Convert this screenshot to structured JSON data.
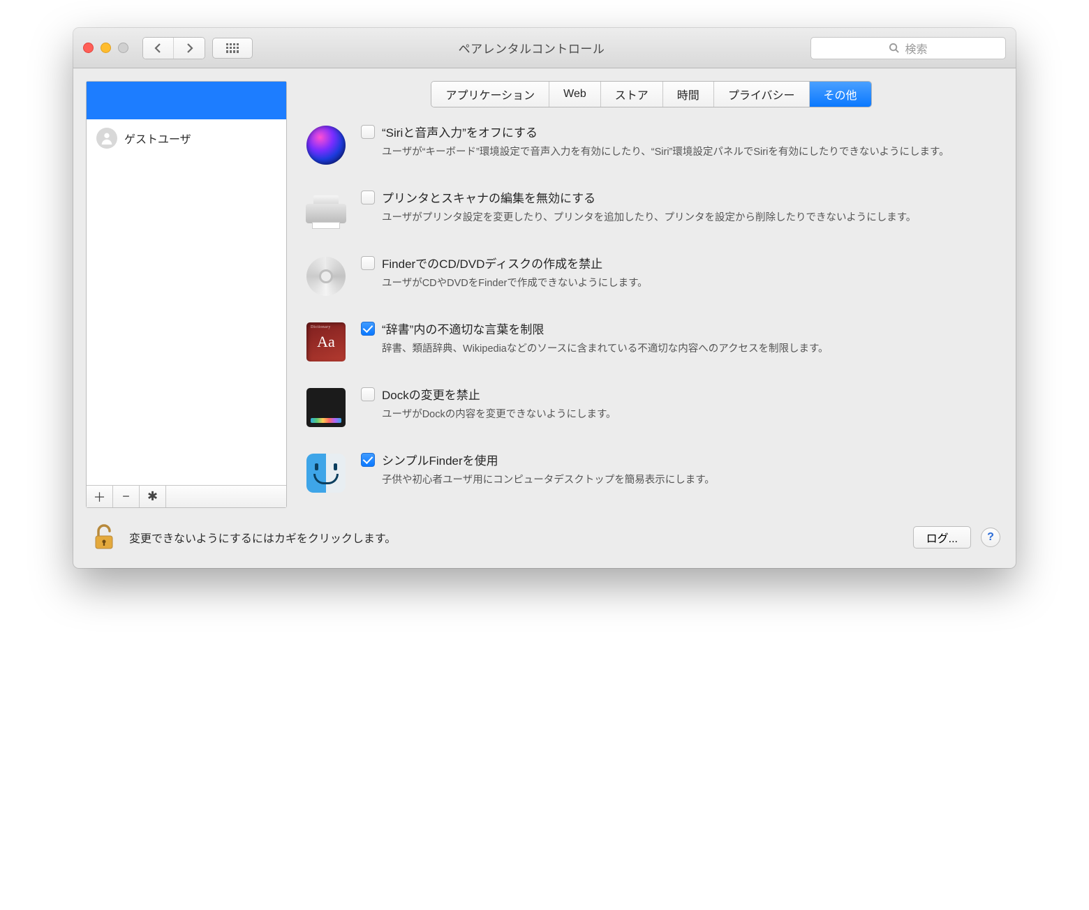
{
  "window": {
    "title": "ペアレンタルコントロール",
    "search_placeholder": "検索"
  },
  "sidebar": {
    "users": [
      {
        "name": "ゲストユーザ"
      }
    ]
  },
  "tabs": [
    {
      "label": "アプリケーション",
      "active": false
    },
    {
      "label": "Web",
      "active": false
    },
    {
      "label": "ストア",
      "active": false
    },
    {
      "label": "時間",
      "active": false
    },
    {
      "label": "プライバシー",
      "active": false
    },
    {
      "label": "その他",
      "active": true
    }
  ],
  "options": [
    {
      "icon": "siri",
      "label": "“Siriと音声入力”をオフにする",
      "desc": "ユーザが“キーボード”環境設定で音声入力を有効にしたり、“Siri”環境設定パネルでSiriを有効にしたりできないようにします。",
      "checked": false
    },
    {
      "icon": "printer",
      "label": "プリンタとスキャナの編集を無効にする",
      "desc": "ユーザがプリンタ設定を変更したり、プリンタを追加したり、プリンタを設定から削除したりできないようにします。",
      "checked": false
    },
    {
      "icon": "disc",
      "label": "FinderでのCD/DVDディスクの作成を禁止",
      "desc": "ユーザがCDやDVDをFinderで作成できないようにします。",
      "checked": false
    },
    {
      "icon": "dictionary",
      "label": "“辞書”内の不適切な言葉を制限",
      "desc": "辞書、類語辞典、Wikipediaなどのソースに含まれている不適切な内容へのアクセスを制限します。",
      "checked": true
    },
    {
      "icon": "dock",
      "label": "Dockの変更を禁止",
      "desc": "ユーザがDockの内容を変更できないようにします。",
      "checked": false
    },
    {
      "icon": "finder",
      "label": "シンプルFinderを使用",
      "desc": "子供や初心者ユーザ用にコンピュータデスクトップを簡易表示にします。",
      "checked": true
    }
  ],
  "footer": {
    "lock_text": "変更できないようにするにはカギをクリックします。",
    "log_button": "ログ...",
    "help": "?"
  },
  "dictionary_glyph": "Aa"
}
